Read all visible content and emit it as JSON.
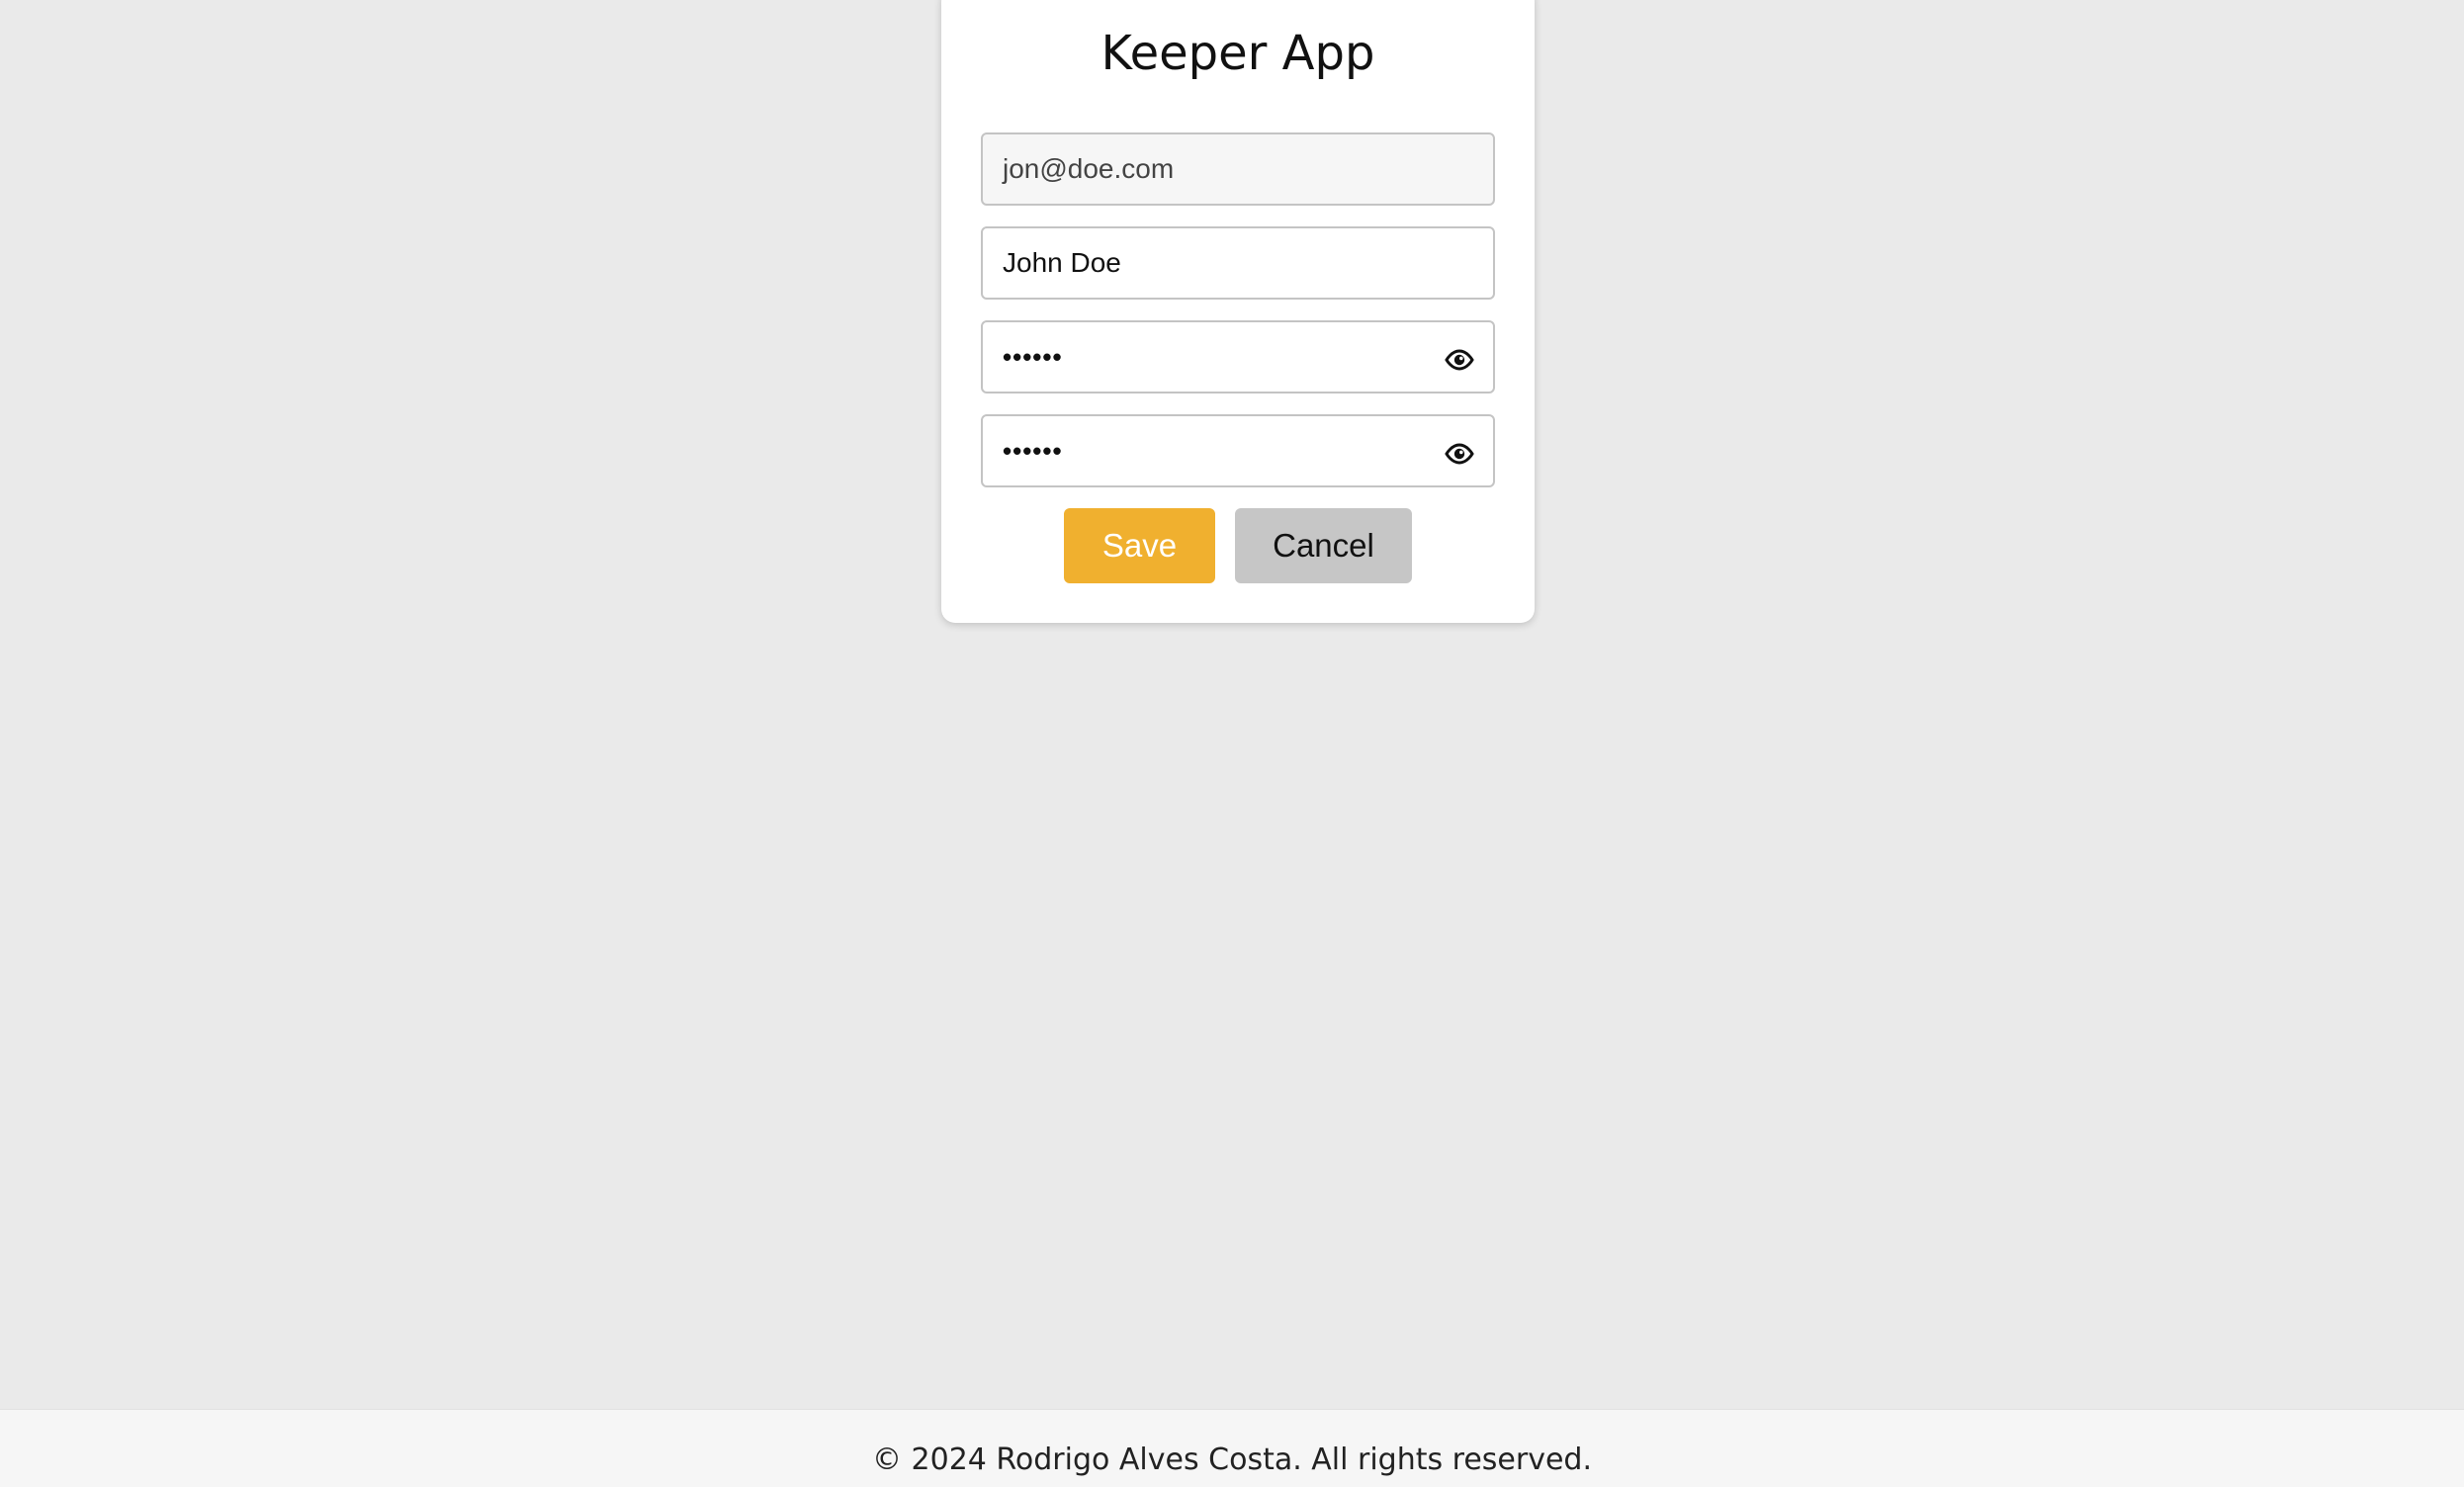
{
  "app": {
    "title": "Keeper App"
  },
  "form": {
    "email": {
      "value": "jon@doe.com",
      "readonly": true
    },
    "name": {
      "value": "John Doe"
    },
    "password": {
      "value": "••••••"
    },
    "confirm_password": {
      "value": "••••••"
    },
    "toggle_icon": "eye-icon"
  },
  "actions": {
    "save_label": "Save",
    "cancel_label": "Cancel"
  },
  "footer": {
    "text": "© 2024 Rodrigo Alves Costa. All rights reserved."
  },
  "colors": {
    "background": "#eaeaea",
    "card": "#ffffff",
    "save_button": "#f0b02f",
    "cancel_button": "#c6c6c6",
    "footer": "#f6f6f6"
  }
}
